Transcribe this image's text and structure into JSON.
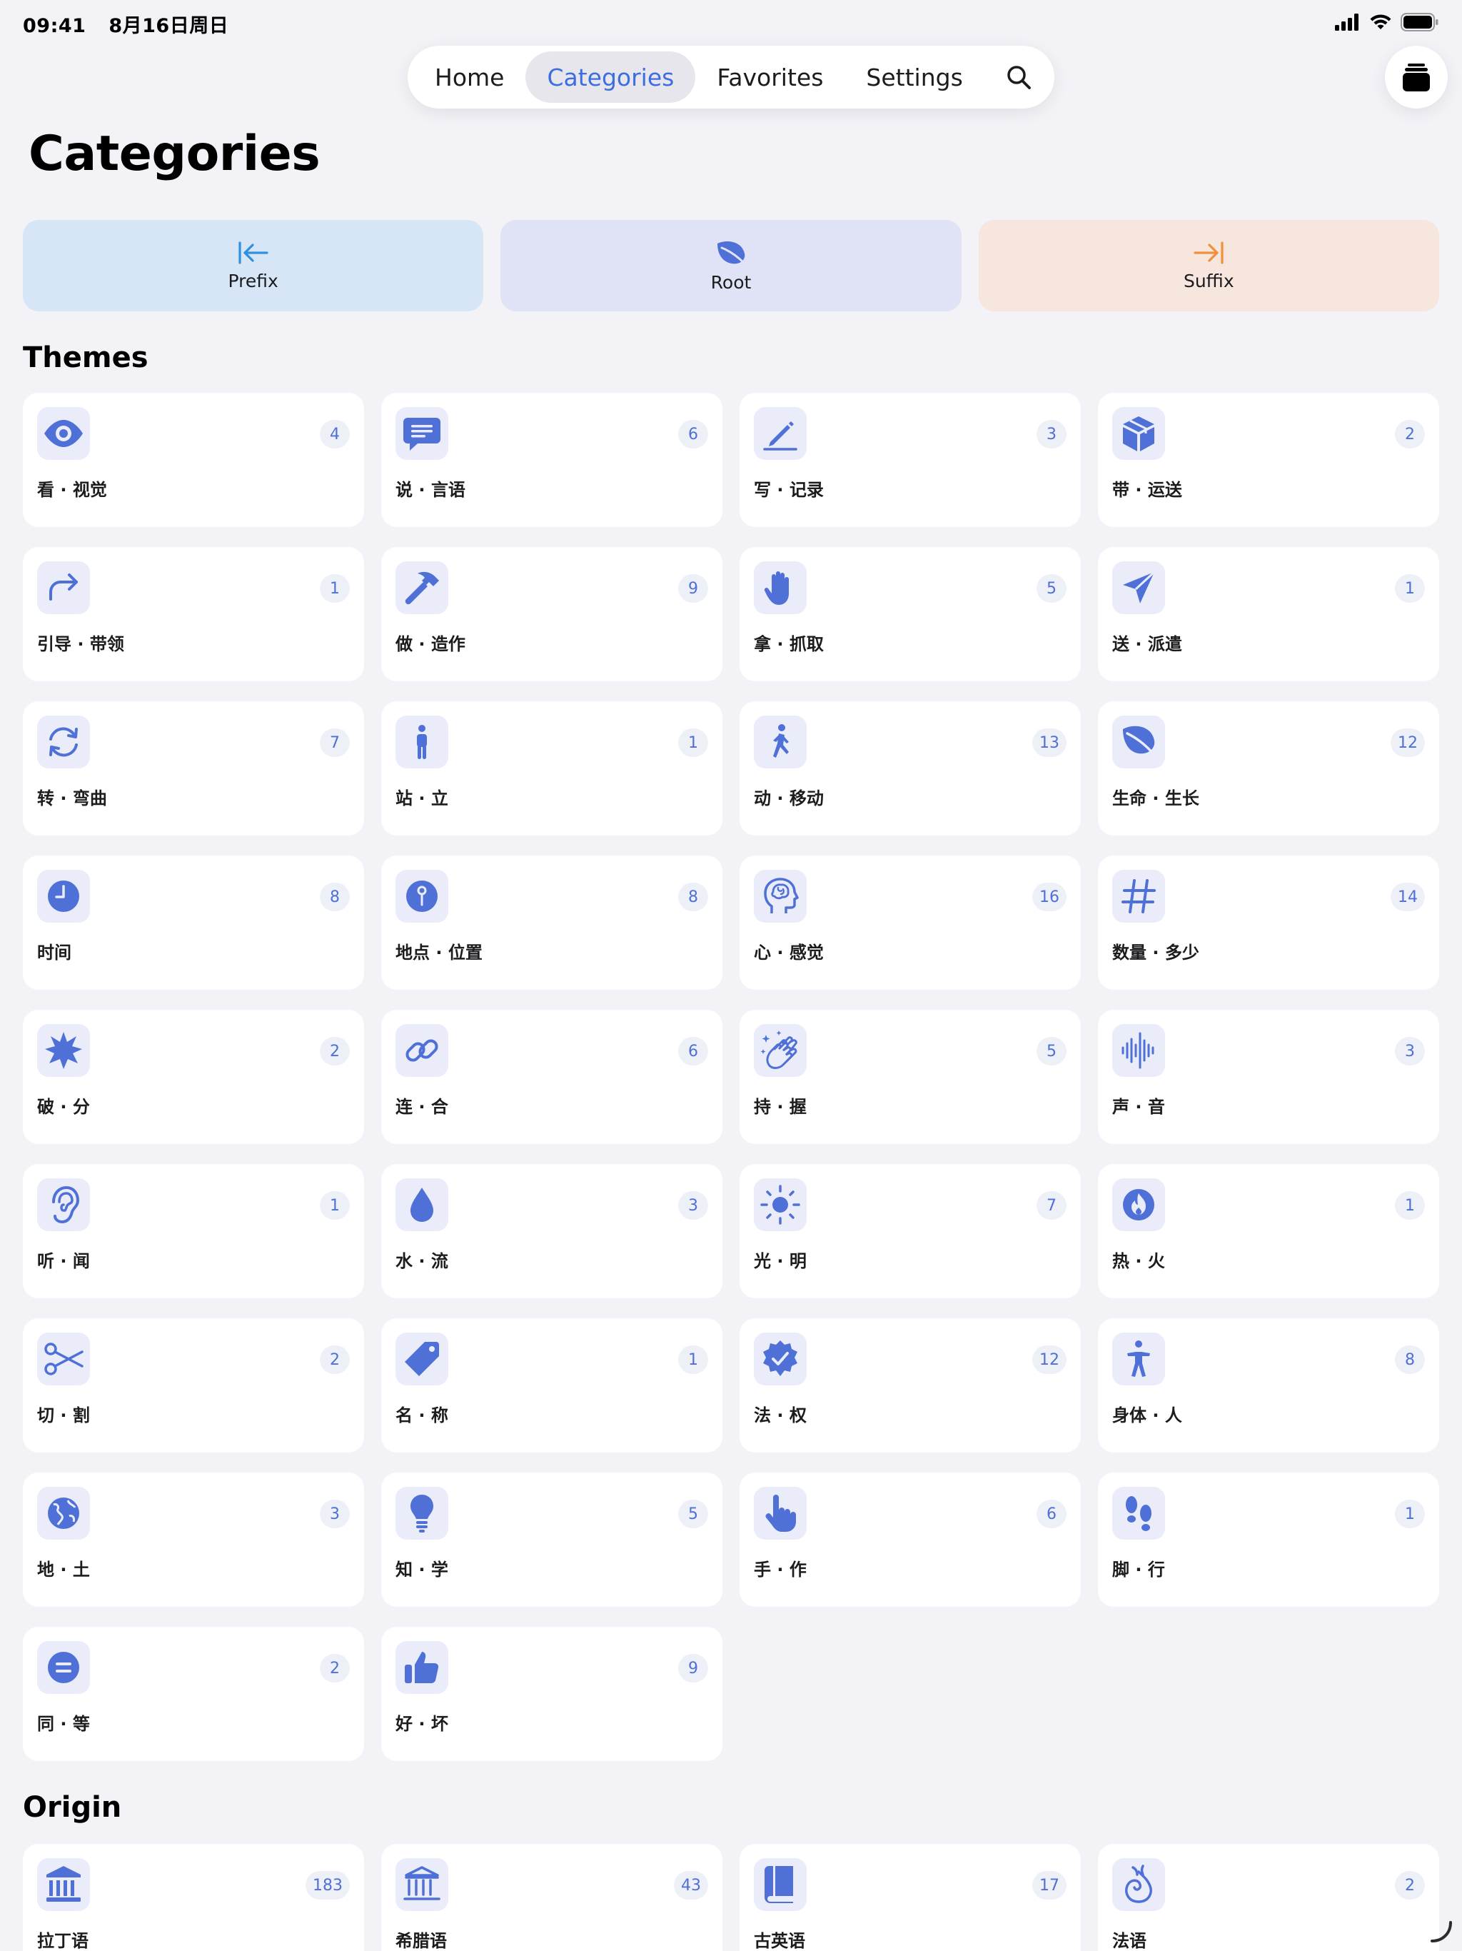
{
  "status_bar": {
    "time": "09:41",
    "date": "8月16日周日"
  },
  "nav": {
    "tabs": [
      {
        "label": "Home"
      },
      {
        "label": "Categories"
      },
      {
        "label": "Favorites"
      },
      {
        "label": "Settings"
      }
    ],
    "active_tab": "Categories",
    "search_icon": "search-icon"
  },
  "page_title": "Categories",
  "affixes": [
    {
      "label": "Prefix",
      "icon": "arrow-left-to-bar-icon",
      "color": "#2f8fe0"
    },
    {
      "label": "Root",
      "icon": "leaf-icon",
      "color": "#4f70d6"
    },
    {
      "label": "Suffix",
      "icon": "arrow-right-to-bar-icon",
      "color": "#f0903c"
    }
  ],
  "themes_title": "Themes",
  "themes": [
    {
      "name": "看 · 视觉",
      "count": "4",
      "icon": "eye-icon"
    },
    {
      "name": "说 · 言语",
      "count": "6",
      "icon": "speech-bubble-icon"
    },
    {
      "name": "写 · 记录",
      "count": "3",
      "icon": "pencil-icon"
    },
    {
      "name": "带 · 运送",
      "count": "2",
      "icon": "box-icon"
    },
    {
      "name": "引导 · 带领",
      "count": "1",
      "icon": "forward-arrow-icon"
    },
    {
      "name": "做 · 造作",
      "count": "9",
      "icon": "hammer-icon"
    },
    {
      "name": "拿 · 抓取",
      "count": "5",
      "icon": "hand-icon"
    },
    {
      "name": "送 · 派遣",
      "count": "1",
      "icon": "paper-plane-icon"
    },
    {
      "name": "转 · 弯曲",
      "count": "7",
      "icon": "rotate-arrows-icon"
    },
    {
      "name": "站 · 立",
      "count": "1",
      "icon": "standing-person-icon"
    },
    {
      "name": "动 · 移动",
      "count": "13",
      "icon": "walking-person-icon"
    },
    {
      "name": "生命 · 生长",
      "count": "12",
      "icon": "leaf-icon"
    },
    {
      "name": "时间",
      "count": "8",
      "icon": "clock-icon"
    },
    {
      "name": "地点 · 位置",
      "count": "8",
      "icon": "map-pin-icon"
    },
    {
      "name": "心 · 感觉",
      "count": "16",
      "icon": "brain-head-icon"
    },
    {
      "name": "数量 · 多少",
      "count": "14",
      "icon": "number-sign-icon"
    },
    {
      "name": "破 · 分",
      "count": "2",
      "icon": "burst-icon"
    },
    {
      "name": "连 · 合",
      "count": "6",
      "icon": "link-icon"
    },
    {
      "name": "持 · 握",
      "count": "5",
      "icon": "clapping-hands-icon"
    },
    {
      "name": "声 · 音",
      "count": "3",
      "icon": "waveform-icon"
    },
    {
      "name": "听 · 闻",
      "count": "1",
      "icon": "ear-icon"
    },
    {
      "name": "水 · 流",
      "count": "3",
      "icon": "drop-icon"
    },
    {
      "name": "光 · 明",
      "count": "7",
      "icon": "sun-icon"
    },
    {
      "name": "热 · 火",
      "count": "1",
      "icon": "flame-icon"
    },
    {
      "name": "切 · 割",
      "count": "2",
      "icon": "scissors-icon"
    },
    {
      "name": "名 · 称",
      "count": "1",
      "icon": "tag-icon"
    },
    {
      "name": "法 · 权",
      "count": "12",
      "icon": "checkmark-seal-icon"
    },
    {
      "name": "身体 · 人",
      "count": "8",
      "icon": "human-figure-icon"
    },
    {
      "name": "地 · 土",
      "count": "3",
      "icon": "globe-icon"
    },
    {
      "name": "知 · 学",
      "count": "5",
      "icon": "lightbulb-icon"
    },
    {
      "name": "手 · 作",
      "count": "6",
      "icon": "pointing-hand-icon"
    },
    {
      "name": "脚 · 行",
      "count": "1",
      "icon": "footprints-icon"
    },
    {
      "name": "同 · 等",
      "count": "2",
      "icon": "equal-circle-icon"
    },
    {
      "name": "好 · 坏",
      "count": "9",
      "icon": "thumbs-up-icon"
    }
  ],
  "origin_title": "Origin",
  "origins": [
    {
      "name": "拉丁语",
      "count": "183",
      "icon": "building-columns-icon"
    },
    {
      "name": "希腊语",
      "count": "43",
      "icon": "building-columns-outline-icon"
    },
    {
      "name": "古英语",
      "count": "17",
      "icon": "book-icon"
    },
    {
      "name": "法语",
      "count": "2",
      "icon": "swirl-icon"
    }
  ],
  "colors": {
    "accent": "#3d6ee0",
    "icon": "#4f70d6",
    "icon_bg": "#eaedf9",
    "background": "#f2f2f7"
  }
}
